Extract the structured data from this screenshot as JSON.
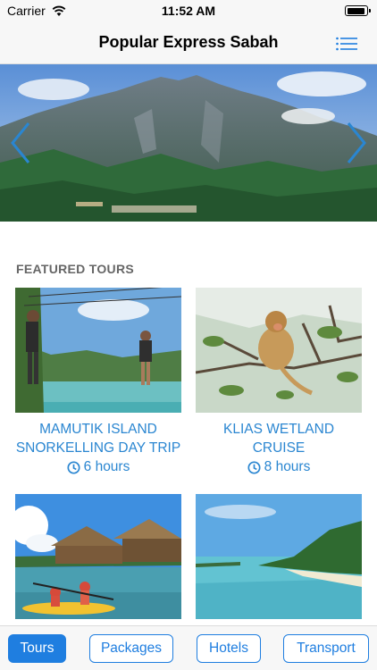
{
  "status_bar": {
    "carrier": "Carrier",
    "time": "11:52 AM"
  },
  "nav": {
    "title": "Popular Express Sabah",
    "menu_icon": "list-icon"
  },
  "hero": {
    "prev_icon": "chevron-left-icon",
    "next_icon": "chevron-right-icon"
  },
  "featured": {
    "title": "FEATURED TOURS",
    "tours": [
      {
        "name_line1": "MAMUTIK ISLAND",
        "name_line2": "SNORKELLING DAY TRIP",
        "duration": "6 hours"
      },
      {
        "name_line1": "KLIAS WETLAND CRUISE",
        "duration": "8 hours"
      },
      {
        "name_line1": "",
        "duration": ""
      },
      {
        "name_line1": "",
        "duration": ""
      }
    ]
  },
  "tabs": [
    {
      "label": "Tours",
      "active": true
    },
    {
      "label": "Packages",
      "active": false
    },
    {
      "label": "Hotels",
      "active": false
    },
    {
      "label": "Transport",
      "active": false
    }
  ],
  "colors": {
    "accent": "#1f7ee0",
    "link": "#2a86d1",
    "section_title": "#666666"
  }
}
